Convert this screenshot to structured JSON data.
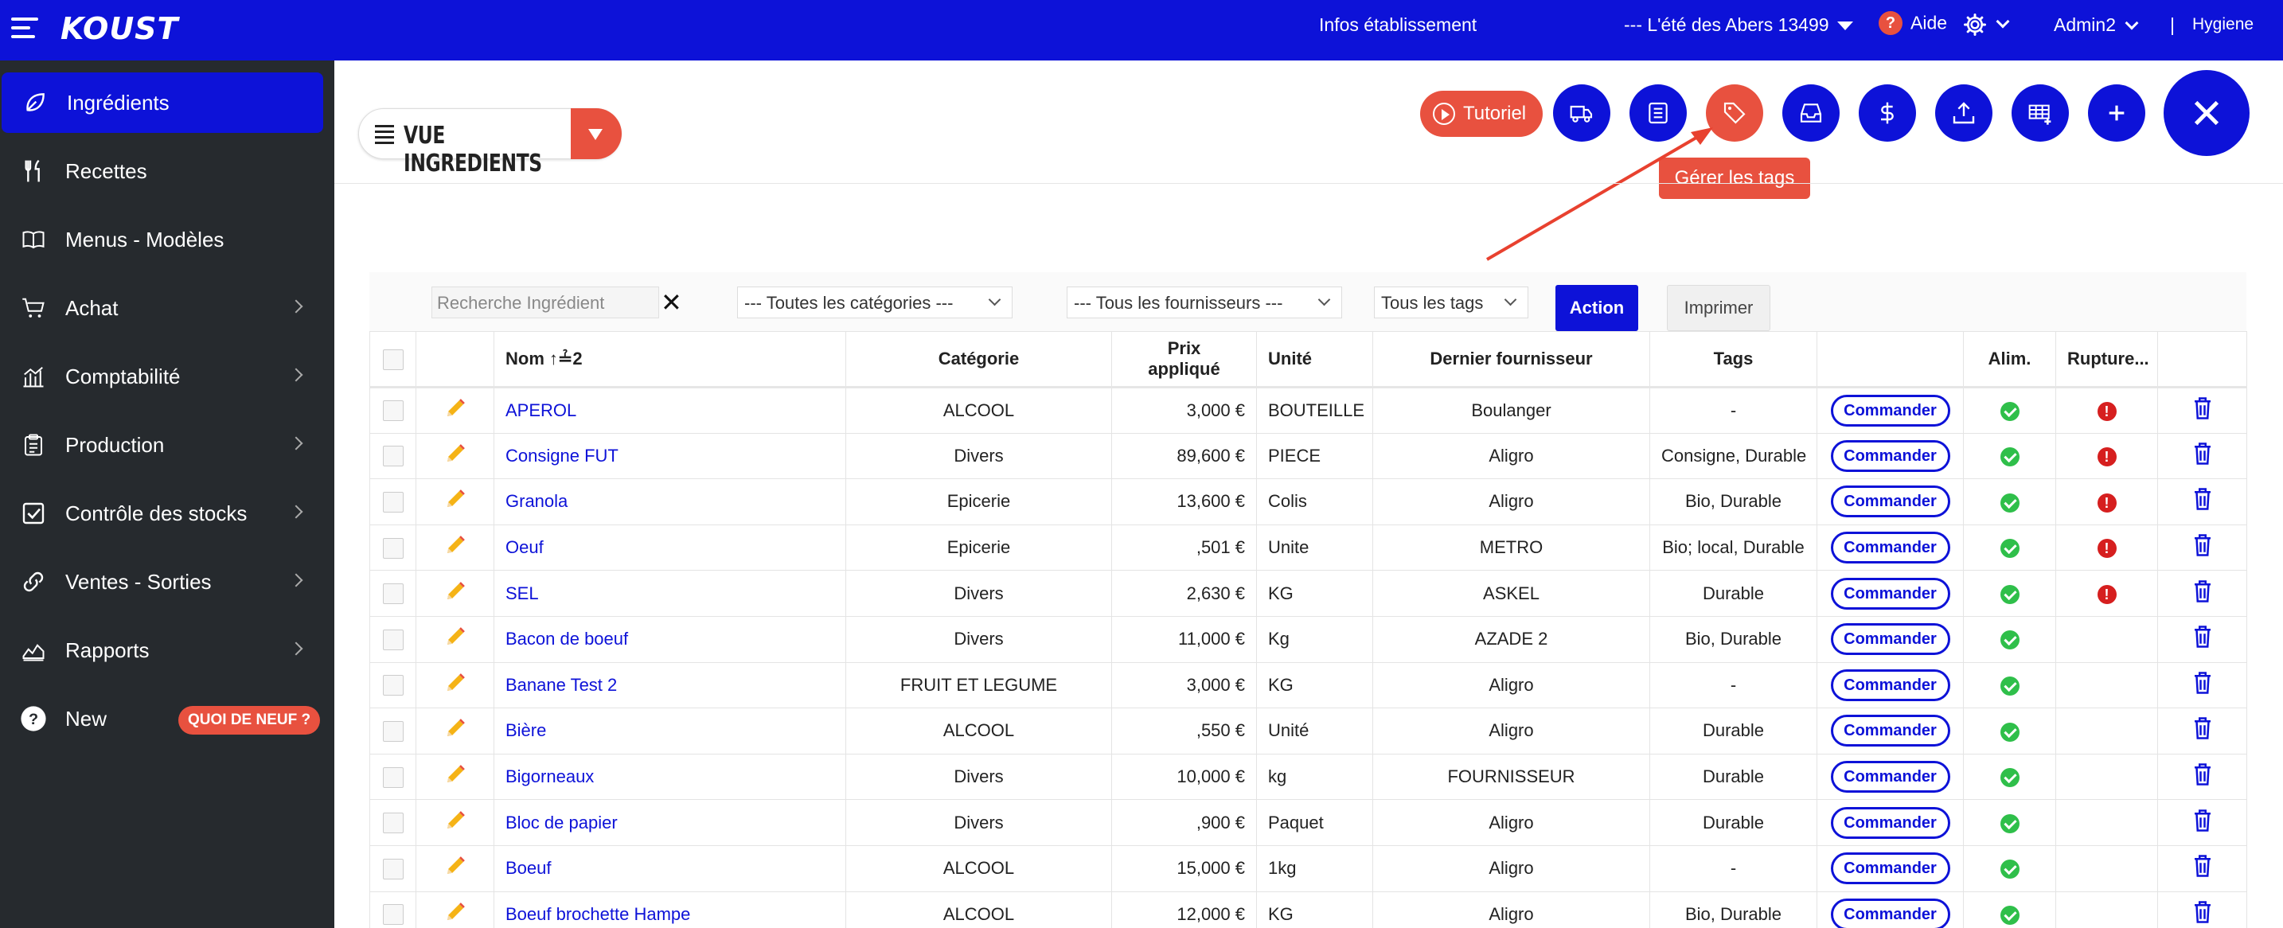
{
  "topbar": {
    "logo": "KOUST",
    "infos": "Infos établissement",
    "establishment": "--- L'été des Abers 13499",
    "help": "Aide",
    "help_icon": "?",
    "user": "Admin2",
    "separator": "|",
    "hygiene": "Hygiene"
  },
  "sidebar": {
    "items": [
      {
        "label": "Ingrédients",
        "icon": "leaf-icon",
        "active": true
      },
      {
        "label": "Recettes",
        "icon": "utensils-icon"
      },
      {
        "label": "Menus - Modèles",
        "icon": "book-icon"
      },
      {
        "label": "Achat",
        "icon": "cart-icon"
      },
      {
        "label": "Comptabilité",
        "icon": "bar-chart-icon"
      },
      {
        "label": "Production",
        "icon": "clipboard-icon"
      },
      {
        "label": "Contrôle des stocks",
        "icon": "checkbox-icon"
      },
      {
        "label": "Ventes - Sorties",
        "icon": "link-icon"
      },
      {
        "label": "Rapports",
        "icon": "area-chart-icon"
      },
      {
        "label": "New",
        "icon": "help-icon",
        "badge": "QUOI DE NEUF ?"
      }
    ]
  },
  "header": {
    "view_label": "VUE INGREDIENTS",
    "tutorial": "Tutoriel",
    "tooltip": "Gérer les tags"
  },
  "filters": {
    "search_placeholder": "Recherche Ingrédient",
    "category": "--- Toutes les catégories ---",
    "supplier": "--- Tous les fournisseurs ---",
    "tags": "Tous les tags",
    "action": "Action",
    "print": "Imprimer"
  },
  "table": {
    "columns": {
      "name": "Nom",
      "sort_badge": "↑≟2",
      "category": "Catégorie",
      "price_1": "Prix",
      "price_2": "appliqué",
      "unit": "Unité",
      "supplier": "Dernier fournisseur",
      "tags": "Tags",
      "alim": "Alim.",
      "rupture": "Rupture..."
    },
    "order_label": "Commander",
    "rows": [
      {
        "name": "APEROL",
        "category": "ALCOOL",
        "price": "3,000 €",
        "unit": "BOUTEILLE",
        "supplier": "Boulanger",
        "tags": "-",
        "alim": true,
        "rupture": true
      },
      {
        "name": "Consigne FUT",
        "category": "Divers",
        "price": "89,600 €",
        "unit": "PIECE",
        "supplier": "Aligro",
        "tags": "Consigne, Durable",
        "alim": true,
        "rupture": true
      },
      {
        "name": "Granola",
        "category": "Epicerie",
        "price": "13,600 €",
        "unit": "Colis",
        "supplier": "Aligro",
        "tags": "Bio, Durable",
        "alim": true,
        "rupture": true
      },
      {
        "name": "Oeuf",
        "category": "Epicerie",
        "price": ",501 €",
        "unit": "Unite",
        "supplier": "METRO",
        "tags": "Bio; local, Durable",
        "alim": true,
        "rupture": true
      },
      {
        "name": "SEL",
        "category": "Divers",
        "price": "2,630 €",
        "unit": "KG",
        "supplier": "ASKEL",
        "tags": "Durable",
        "alim": true,
        "rupture": true
      },
      {
        "name": "Bacon de boeuf",
        "category": "Divers",
        "price": "11,000 €",
        "unit": "Kg",
        "supplier": "AZADE 2",
        "tags": "Bio, Durable",
        "alim": true,
        "rupture": false
      },
      {
        "name": "Banane Test 2",
        "category": "FRUIT ET LEGUME",
        "price": "3,000 €",
        "unit": "KG",
        "supplier": "Aligro",
        "tags": "-",
        "alim": true,
        "rupture": false
      },
      {
        "name": "Bière",
        "category": "ALCOOL",
        "price": ",550 €",
        "unit": "Unité",
        "supplier": "Aligro",
        "tags": "Durable",
        "alim": true,
        "rupture": false
      },
      {
        "name": "Bigorneaux",
        "category": "Divers",
        "price": "10,000 €",
        "unit": "kg",
        "supplier": "FOURNISSEUR",
        "tags": "Durable",
        "alim": true,
        "rupture": false
      },
      {
        "name": "Bloc de papier",
        "category": "Divers",
        "price": ",900 €",
        "unit": "Paquet",
        "supplier": "Aligro",
        "tags": "Durable",
        "alim": true,
        "rupture": false
      },
      {
        "name": "Boeuf",
        "category": "ALCOOL",
        "price": "15,000 €",
        "unit": "1kg",
        "supplier": "Aligro",
        "tags": "-",
        "alim": true,
        "rupture": false
      },
      {
        "name": "Boeuf brochette Hampe",
        "category": "ALCOOL",
        "price": "12,000 €",
        "unit": "KG",
        "supplier": "Aligro",
        "tags": "Bio, Durable",
        "alim": true,
        "rupture": false
      }
    ]
  },
  "colors": {
    "primary": "#0d12d8",
    "accent": "#e8513f",
    "sidebar": "#262a2e",
    "ok": "#2fbf4a",
    "error": "#d61f1f"
  }
}
